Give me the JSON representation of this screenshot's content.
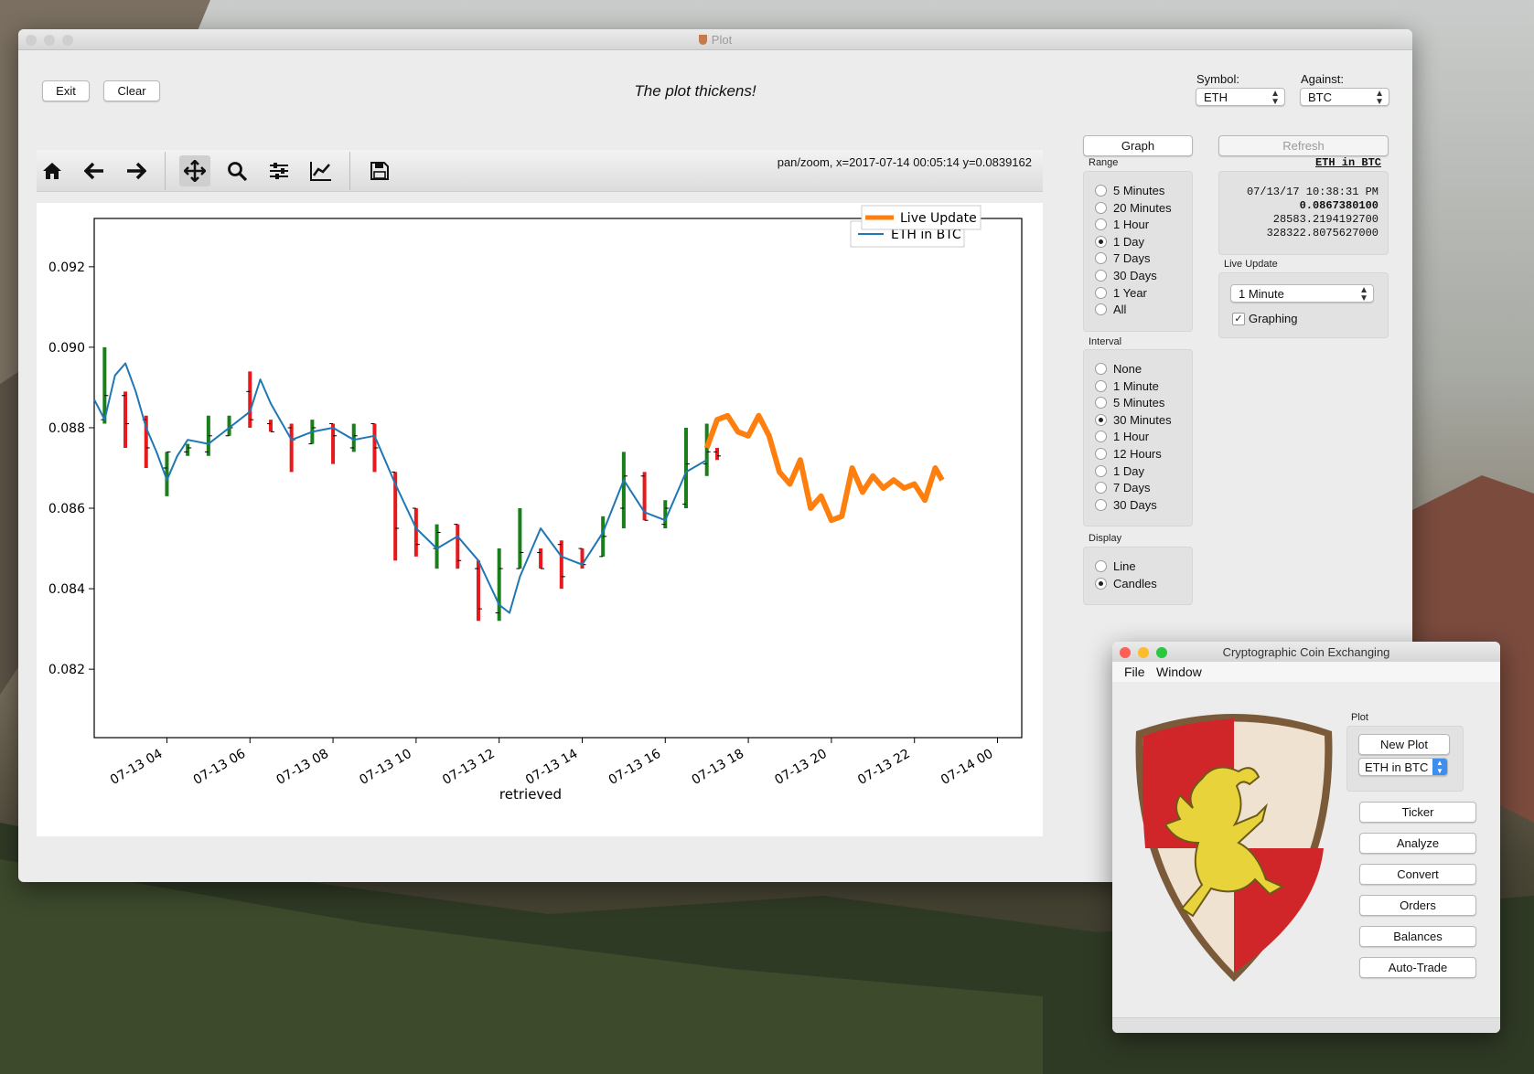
{
  "plot_window": {
    "title": "Plot",
    "exit_label": "Exit",
    "clear_label": "Clear",
    "heading": "The plot thickens!",
    "symbol_label": "Symbol:",
    "symbol_value": "ETH",
    "against_label": "Against:",
    "against_value": "BTC",
    "status": "pan/zoom, x=2017-07-14 00:05:14 y=0.0839162",
    "toolbar": [
      "home-icon",
      "back-arrow-icon",
      "forward-arrow-icon",
      "pan-icon",
      "zoom-icon",
      "configure-subplots-icon",
      "edit-axis-icon",
      "save-icon"
    ],
    "graph_label": "Graph",
    "refresh_label": "Refresh",
    "range_label": "Range",
    "range_options": [
      "5 Minutes",
      "20 Minutes",
      "1 Hour",
      "1 Day",
      "7 Days",
      "30 Days",
      "1 Year",
      "All"
    ],
    "range_selected": 3,
    "interval_label": "Interval",
    "interval_options": [
      "None",
      "1 Minute",
      "5 Minutes",
      "30 Minutes",
      "1 Hour",
      "12 Hours",
      "1 Day",
      "7 Days",
      "30 Days"
    ],
    "interval_selected": 3,
    "display_label": "Display",
    "display_options": [
      "Line",
      "Candles"
    ],
    "display_selected": 1,
    "ticker": {
      "pair": "ETH in BTC",
      "time": "07/13/17 10:38:31 PM",
      "price": "0.0867380100",
      "line2": "28583.2194192700",
      "line3": "328322.8075627000"
    },
    "live_update_label": "Live Update",
    "live_update_value": "1 Minute",
    "graphing_label": "Graphing",
    "graphing_checked": true
  },
  "chart_data": {
    "type": "line",
    "xlabel": "retrieved",
    "ylabel": "",
    "ylim": [
      0.0803,
      0.0932
    ],
    "xlim": [
      "2017-07-13 02:15",
      "2017-07-14 00:35"
    ],
    "yticks": [
      0.082,
      0.084,
      0.086,
      0.088,
      0.09,
      0.092
    ],
    "ytick_labels": [
      "0.082",
      "0.084",
      "0.086",
      "0.088",
      "0.090",
      "0.092"
    ],
    "xticks": [
      "2017-07-13 04:00",
      "2017-07-13 06:00",
      "2017-07-13 08:00",
      "2017-07-13 10:00",
      "2017-07-13 12:00",
      "2017-07-13 14:00",
      "2017-07-13 16:00",
      "2017-07-13 18:00",
      "2017-07-13 20:00",
      "2017-07-13 22:00",
      "2017-07-14 00:00"
    ],
    "xtick_labels": [
      "07-13 04",
      "07-13 06",
      "07-13 08",
      "07-13 10",
      "07-13 12",
      "07-13 14",
      "07-13 16",
      "07-13 18",
      "07-13 20",
      "07-13 22",
      "07-14 00"
    ],
    "legend": {
      "placement": "upper-right"
    },
    "series": [
      {
        "name": "ETH in BTC",
        "color": "#1f77b4",
        "x": [
          "2017-07-13 02:15",
          "2017-07-13 02:30",
          "2017-07-13 02:45",
          "2017-07-13 03:00",
          "2017-07-13 03:15",
          "2017-07-13 03:30",
          "2017-07-13 03:45",
          "2017-07-13 04:00",
          "2017-07-13 04:15",
          "2017-07-13 04:30",
          "2017-07-13 05:00",
          "2017-07-13 05:30",
          "2017-07-13 06:00",
          "2017-07-13 06:15",
          "2017-07-13 06:30",
          "2017-07-13 07:00",
          "2017-07-13 07:30",
          "2017-07-13 08:00",
          "2017-07-13 08:30",
          "2017-07-13 09:00",
          "2017-07-13 09:30",
          "2017-07-13 10:00",
          "2017-07-13 10:30",
          "2017-07-13 11:00",
          "2017-07-13 11:30",
          "2017-07-13 12:00",
          "2017-07-13 12:15",
          "2017-07-13 12:30",
          "2017-07-13 13:00",
          "2017-07-13 13:30",
          "2017-07-13 14:00",
          "2017-07-13 14:30",
          "2017-07-13 15:00",
          "2017-07-13 15:30",
          "2017-07-13 16:00",
          "2017-07-13 16:30",
          "2017-07-13 17:00"
        ],
        "values": [
          0.0887,
          0.0882,
          0.0893,
          0.0896,
          0.0889,
          0.088,
          0.0874,
          0.0867,
          0.0873,
          0.0877,
          0.0876,
          0.088,
          0.0884,
          0.0892,
          0.0886,
          0.0877,
          0.0879,
          0.088,
          0.0877,
          0.0878,
          0.0866,
          0.0855,
          0.085,
          0.0853,
          0.0847,
          0.0836,
          0.0834,
          0.0843,
          0.0855,
          0.0848,
          0.0846,
          0.0854,
          0.0867,
          0.0859,
          0.0857,
          0.0869,
          0.0872
        ]
      },
      {
        "name": "Live Update",
        "color": "#ff7f0e",
        "x": [
          "2017-07-13 17:00",
          "2017-07-13 17:15",
          "2017-07-13 17:30",
          "2017-07-13 17:45",
          "2017-07-13 18:00",
          "2017-07-13 18:15",
          "2017-07-13 18:30",
          "2017-07-13 18:45",
          "2017-07-13 19:00",
          "2017-07-13 19:15",
          "2017-07-13 19:30",
          "2017-07-13 19:45",
          "2017-07-13 20:00",
          "2017-07-13 20:15",
          "2017-07-13 20:30",
          "2017-07-13 20:45",
          "2017-07-13 21:00",
          "2017-07-13 21:15",
          "2017-07-13 21:30",
          "2017-07-13 21:45",
          "2017-07-13 22:00",
          "2017-07-13 22:15",
          "2017-07-13 22:30",
          "2017-07-13 22:40"
        ],
        "values": [
          0.0875,
          0.0882,
          0.0883,
          0.0879,
          0.0878,
          0.0883,
          0.0878,
          0.0869,
          0.0866,
          0.0872,
          0.086,
          0.0863,
          0.0857,
          0.0858,
          0.087,
          0.0864,
          0.0868,
          0.0865,
          0.0867,
          0.0865,
          0.0866,
          0.0862,
          0.087,
          0.0867
        ]
      }
    ],
    "candles": [
      {
        "x": "2017-07-13 02:30",
        "o": 0.0882,
        "c": 0.0888,
        "l": 0.0881,
        "h": 0.09
      },
      {
        "x": "2017-07-13 03:00",
        "o": 0.0888,
        "c": 0.0881,
        "l": 0.0875,
        "h": 0.0889
      },
      {
        "x": "2017-07-13 03:30",
        "o": 0.0882,
        "c": 0.0875,
        "l": 0.087,
        "h": 0.0883
      },
      {
        "x": "2017-07-13 04:00",
        "o": 0.087,
        "c": 0.0874,
        "l": 0.0863,
        "h": 0.0874
      },
      {
        "x": "2017-07-13 04:30",
        "o": 0.0874,
        "c": 0.0875,
        "l": 0.0873,
        "h": 0.0876
      },
      {
        "x": "2017-07-13 05:00",
        "o": 0.0874,
        "c": 0.0878,
        "l": 0.0873,
        "h": 0.0883
      },
      {
        "x": "2017-07-13 05:30",
        "o": 0.0878,
        "c": 0.088,
        "l": 0.0878,
        "h": 0.0883
      },
      {
        "x": "2017-07-13 06:00",
        "o": 0.0889,
        "c": 0.0882,
        "l": 0.088,
        "h": 0.0894
      },
      {
        "x": "2017-07-13 06:30",
        "o": 0.0881,
        "c": 0.0879,
        "l": 0.0879,
        "h": 0.0882
      },
      {
        "x": "2017-07-13 07:00",
        "o": 0.088,
        "c": 0.0877,
        "l": 0.0869,
        "h": 0.0881
      },
      {
        "x": "2017-07-13 07:30",
        "o": 0.0876,
        "c": 0.088,
        "l": 0.0876,
        "h": 0.0882
      },
      {
        "x": "2017-07-13 08:00",
        "o": 0.0881,
        "c": 0.0878,
        "l": 0.0871,
        "h": 0.0881
      },
      {
        "x": "2017-07-13 08:30",
        "o": 0.0875,
        "c": 0.0878,
        "l": 0.0874,
        "h": 0.0881
      },
      {
        "x": "2017-07-13 09:00",
        "o": 0.0881,
        "c": 0.0875,
        "l": 0.0869,
        "h": 0.0881
      },
      {
        "x": "2017-07-13 09:30",
        "o": 0.0869,
        "c": 0.0855,
        "l": 0.0847,
        "h": 0.0869
      },
      {
        "x": "2017-07-13 10:00",
        "o": 0.086,
        "c": 0.0851,
        "l": 0.0848,
        "h": 0.086
      },
      {
        "x": "2017-07-13 10:30",
        "o": 0.085,
        "c": 0.0854,
        "l": 0.0845,
        "h": 0.0856
      },
      {
        "x": "2017-07-13 11:00",
        "o": 0.0856,
        "c": 0.0847,
        "l": 0.0845,
        "h": 0.0856
      },
      {
        "x": "2017-07-13 11:30",
        "o": 0.0845,
        "c": 0.0835,
        "l": 0.0832,
        "h": 0.0847
      },
      {
        "x": "2017-07-13 12:00",
        "o": 0.0834,
        "c": 0.0845,
        "l": 0.0832,
        "h": 0.085
      },
      {
        "x": "2017-07-13 12:30",
        "o": 0.0845,
        "c": 0.0849,
        "l": 0.0845,
        "h": 0.086
      },
      {
        "x": "2017-07-13 13:00",
        "o": 0.0849,
        "c": 0.0845,
        "l": 0.0845,
        "h": 0.085
      },
      {
        "x": "2017-07-13 13:30",
        "o": 0.0851,
        "c": 0.0843,
        "l": 0.084,
        "h": 0.0852
      },
      {
        "x": "2017-07-13 14:00",
        "o": 0.085,
        "c": 0.0846,
        "l": 0.0845,
        "h": 0.085
      },
      {
        "x": "2017-07-13 14:30",
        "o": 0.0848,
        "c": 0.0853,
        "l": 0.0848,
        "h": 0.0858
      },
      {
        "x": "2017-07-13 15:00",
        "o": 0.086,
        "c": 0.0868,
        "l": 0.0855,
        "h": 0.0874
      },
      {
        "x": "2017-07-13 15:30",
        "o": 0.0868,
        "c": 0.0857,
        "l": 0.0857,
        "h": 0.0869
      },
      {
        "x": "2017-07-13 16:00",
        "o": 0.0856,
        "c": 0.086,
        "l": 0.0855,
        "h": 0.0862
      },
      {
        "x": "2017-07-13 16:30",
        "o": 0.0861,
        "c": 0.0871,
        "l": 0.086,
        "h": 0.088
      },
      {
        "x": "2017-07-13 17:00",
        "o": 0.0871,
        "c": 0.0874,
        "l": 0.0868,
        "h": 0.0881
      },
      {
        "x": "2017-07-13 17:15",
        "o": 0.0874,
        "c": 0.0873,
        "l": 0.0872,
        "h": 0.0875
      }
    ]
  },
  "app_window": {
    "title": "Cryptographic Coin Exchanging",
    "menu": [
      "File",
      "Window"
    ],
    "plot_label": "Plot",
    "new_plot_label": "New Plot",
    "pair_value": "ETH in BTC",
    "buttons": [
      "Ticker",
      "Analyze",
      "Convert",
      "Orders",
      "Balances",
      "Auto-Trade"
    ]
  },
  "colors": {
    "up": "#1a7f1a",
    "down": "#e8191c",
    "line": "#1f77b4",
    "live": "#ff7f0e",
    "shield_red": "#d0262a",
    "shield_cream": "#efe2d0",
    "griffin": "#e8d43a"
  }
}
